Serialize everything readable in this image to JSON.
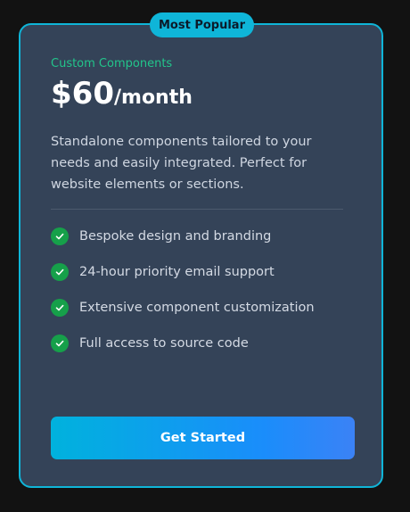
{
  "badge": {
    "label": "Most Popular"
  },
  "plan": {
    "category": "Custom Components",
    "price": "$60",
    "period": "/month",
    "description": "Standalone components tailored to your needs and easily integrated. Perfect for website elements or sections."
  },
  "features": [
    {
      "label": "Bespoke design and branding",
      "icon": "check-circle-icon"
    },
    {
      "label": "24-hour priority email support",
      "icon": "check-circle-icon"
    },
    {
      "label": "Extensive component customization",
      "icon": "check-circle-icon"
    },
    {
      "label": "Full access to source code",
      "icon": "check-circle-icon"
    }
  ],
  "cta": {
    "label": "Get Started"
  },
  "colors": {
    "background": "#121212",
    "card": "#344358",
    "accent": "#0fb5d8",
    "category": "#22c58b",
    "check": "#16a04a",
    "button_start": "#00b2dd",
    "button_end": "#3b82f6"
  }
}
